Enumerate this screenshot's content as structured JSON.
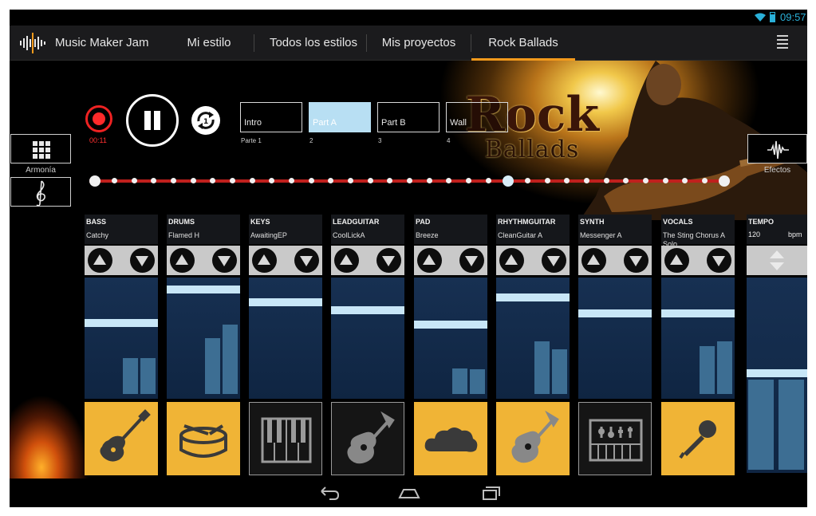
{
  "status": {
    "time": "09:57"
  },
  "app": {
    "title": "Music Maker Jam",
    "tabs": [
      {
        "label": "Mi estilo"
      },
      {
        "label": "Todos los estilos"
      },
      {
        "label": "Mis proyectos"
      },
      {
        "label": "Rock Ballads",
        "active": true
      }
    ],
    "accent_color": "#f39a1c"
  },
  "banner": {
    "title_line1": "Rock",
    "title_line2": "Ballads"
  },
  "transport": {
    "record_time": "00:11",
    "state": "playing",
    "record_color": "#ff2a2a"
  },
  "parts": [
    {
      "name": "Intro",
      "number": "Parte 1",
      "selected": false
    },
    {
      "name": "Part A",
      "number": "2",
      "selected": true
    },
    {
      "name": "Part B",
      "number": "3",
      "selected": false
    },
    {
      "name": "Wall",
      "number": "4",
      "selected": false
    }
  ],
  "side": {
    "harmony_label": "Armonía",
    "effects_label": "Efectos"
  },
  "timeline": {
    "dots": 33,
    "playhead_index": 21,
    "timeline_color": "#c0201d"
  },
  "channels": [
    {
      "name": "BASS",
      "loop": "Catchy",
      "icon": "electric-guitar-icon",
      "active": true,
      "volume": 0.62,
      "meters": [
        0.32,
        0.32
      ]
    },
    {
      "name": "DRUMS",
      "loop": "Flamed H",
      "icon": "drum-icon",
      "active": true,
      "volume": 0.97,
      "meters": [
        0.5,
        0.62
      ]
    },
    {
      "name": "KEYS",
      "loop": "AwaitingEP",
      "icon": "piano-icon",
      "active": false,
      "volume": 0.83,
      "meters": [
        0,
        0
      ]
    },
    {
      "name": "LEADGUITAR",
      "loop": "CoolLickA",
      "icon": "acoustic-guitar-icon",
      "active": false,
      "volume": 0.75,
      "meters": [
        0,
        0
      ]
    },
    {
      "name": "PAD",
      "loop": "Breeze",
      "icon": "cloud-icon",
      "active": true,
      "volume": 0.6,
      "meters": [
        0.23,
        0.22
      ]
    },
    {
      "name": "RHYTHMGUITAR",
      "loop": "CleanGuitar A",
      "icon": "acoustic-guitar-icon",
      "active": true,
      "volume": 0.88,
      "meters": [
        0.47,
        0.4
      ]
    },
    {
      "name": "SYNTH",
      "loop": "Messenger A",
      "icon": "synth-icon",
      "active": false,
      "volume": 0.72,
      "meters": [
        0,
        0
      ]
    },
    {
      "name": "VOCALS",
      "loop": "The Sting Chorus A Solo",
      "icon": "microphone-icon",
      "active": true,
      "volume": 0.72,
      "meters": [
        0.43,
        0.47
      ]
    }
  ],
  "tempo": {
    "label": "TEMPO",
    "value": "120",
    "unit": "bpm",
    "level": 0.51
  }
}
